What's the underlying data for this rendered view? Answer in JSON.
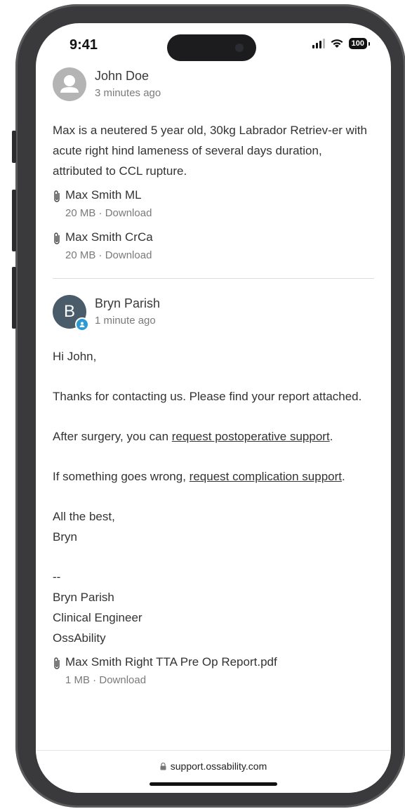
{
  "status": {
    "time": "9:41",
    "battery": "100"
  },
  "messages": [
    {
      "author": "John Doe",
      "time": "3 minutes ago",
      "body": "Max is a neutered 5 year old, 30kg Labrador Retriev-er with acute right hind lameness of several days duration, attributed to CCL rupture.",
      "attachments": [
        {
          "name": "Max Smith ML",
          "size": "20 MB",
          "action": "Download"
        },
        {
          "name": "Max Smith CrCa",
          "size": "20 MB",
          "action": "Download"
        }
      ]
    },
    {
      "author": "Bryn Parish",
      "initial": "B",
      "time": "1 minute ago",
      "greeting": "Hi John,",
      "para1": "Thanks for contacting us. Please find your report attached.",
      "para2_prefix": "After surgery, you can ",
      "para2_link": "request postoperative support",
      "para2_suffix": ".",
      "para3_prefix": "If something goes wrong, ",
      "para3_link": "request complication support",
      "para3_suffix": ".",
      "closing": "All the best,",
      "sign_name": "Bryn",
      "sig_sep": "--",
      "sig_line1": "Bryn Parish",
      "sig_line2": "Clinical Engineer",
      "sig_line3": "OssAbility",
      "attachments": [
        {
          "name": "Max Smith Right TTA Pre Op Report.pdf",
          "size": "1 MB",
          "action": "Download"
        }
      ]
    }
  ],
  "browser": {
    "url": "support.ossability.com"
  },
  "meta_separator": " · "
}
